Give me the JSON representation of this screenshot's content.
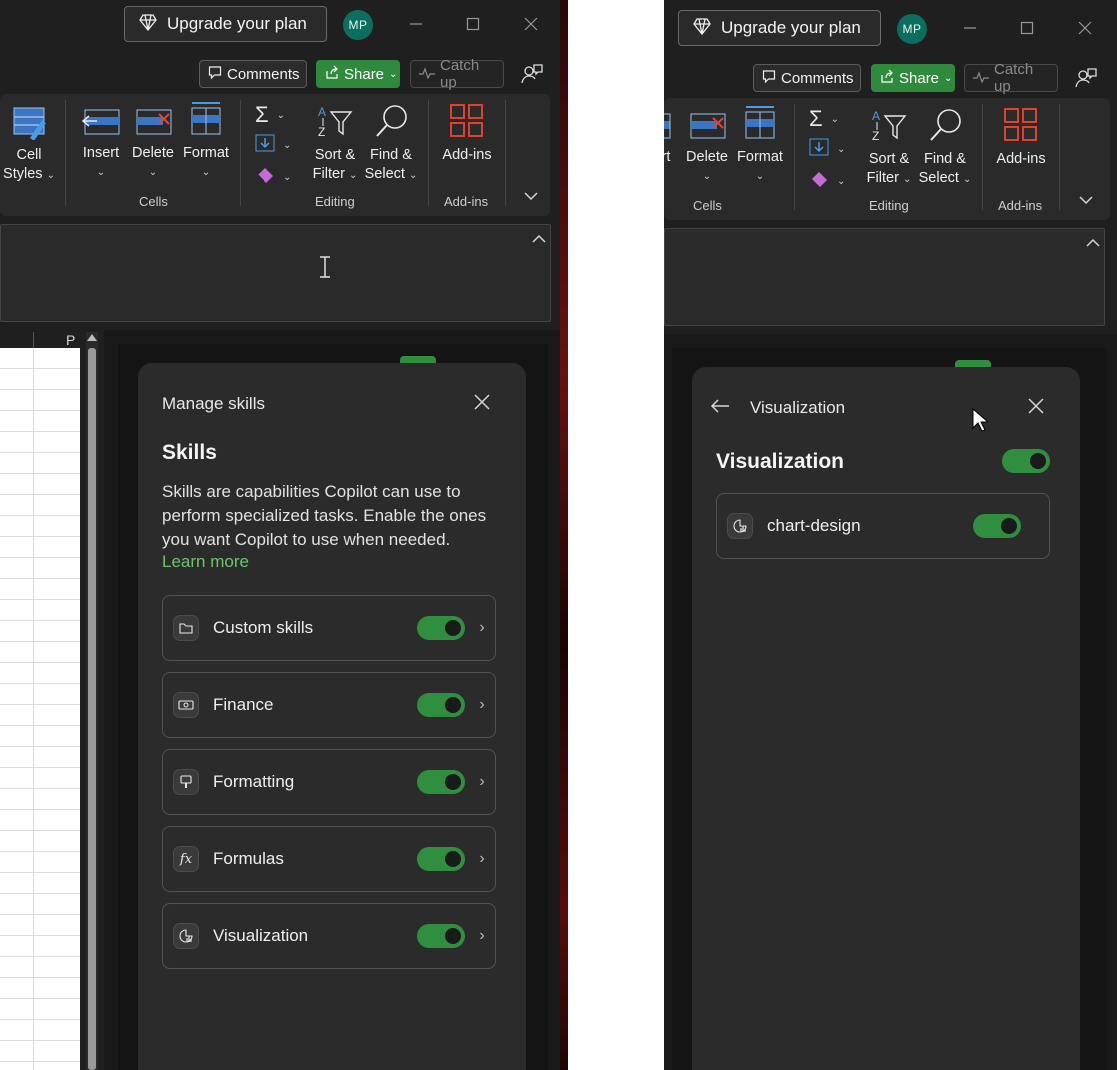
{
  "titlebar": {
    "upgrade_label": "Upgrade your plan",
    "avatar_initials": "MP"
  },
  "toolbar": {
    "comments_label": "Comments",
    "share_label": "Share",
    "catchup_label": "Catch up"
  },
  "ribbon": {
    "cell_styles_line1": "Cell",
    "cell_styles_line2": "Styles",
    "insert_label": "Insert",
    "insert_partial_label": "rt",
    "delete_label": "Delete",
    "format_label": "Format",
    "sort_filter_line1": "Sort &",
    "sort_filter_line2": "Filter",
    "find_select_line1": "Find &",
    "find_select_line2": "Select",
    "addins_label": "Add-ins",
    "group_cells": "Cells",
    "group_editing": "Editing",
    "group_addins": "Add-ins"
  },
  "sheet": {
    "column_p": "P"
  },
  "manage_skills": {
    "header": "Manage skills",
    "heading": "Skills",
    "description": "Skills are capabilities Copilot can use to perform specialized tasks. Enable the ones you want Copilot to use when needed.",
    "learn_more": "Learn more",
    "skills": [
      {
        "name": "Custom skills",
        "icon": "folder-icon",
        "enabled": true
      },
      {
        "name": "Finance",
        "icon": "money-icon",
        "enabled": true
      },
      {
        "name": "Formatting",
        "icon": "paintbrush-icon",
        "enabled": true
      },
      {
        "name": "Formulas",
        "icon": "function-icon",
        "enabled": true
      },
      {
        "name": "Visualization",
        "icon": "chart-icon",
        "enabled": true
      }
    ]
  },
  "visualization": {
    "header": "Visualization",
    "heading": "Visualization",
    "enabled": true,
    "items": [
      {
        "name": "chart-design",
        "icon": "chart-icon",
        "enabled": true
      }
    ]
  },
  "colors": {
    "accent_green": "#2f8f3e",
    "learn_more_green": "#6cc56f",
    "panel_bg": "#2b2b2b",
    "window_bg": "#1f1f1f",
    "addins_orange": "#d9432f"
  }
}
